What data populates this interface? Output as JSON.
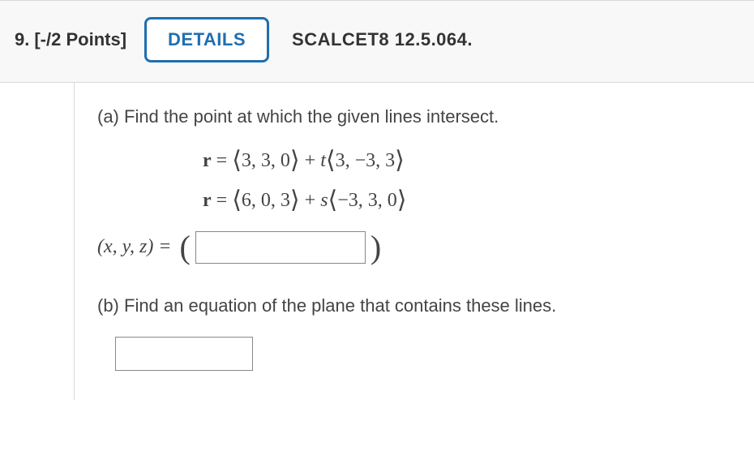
{
  "header": {
    "number": "9.",
    "points": "[-/2 Points]",
    "details_label": "DETAILS",
    "source": "SCALCET8 12.5.064."
  },
  "partA": {
    "text": "(a) Find the point at which the given lines intersect.",
    "eq1": {
      "r": "r",
      "eq": " = ",
      "open": "⟨",
      "v": "3, 3, 0",
      "close": "⟩",
      "plus": " + ",
      "param": "t",
      "open2": "⟨",
      "d": "3, −3, 3",
      "close2": "⟩"
    },
    "eq2": {
      "r": "r",
      "eq": " = ",
      "open": "⟨",
      "v": "6, 0, 3",
      "close": "⟩",
      "plus": " + ",
      "param": "s",
      "open2": "⟨",
      "d": "−3, 3, 0",
      "close2": "⟩"
    },
    "answer_label": "(x, y, z) = "
  },
  "partB": {
    "text": "(b) Find an equation of the plane that contains these lines."
  }
}
